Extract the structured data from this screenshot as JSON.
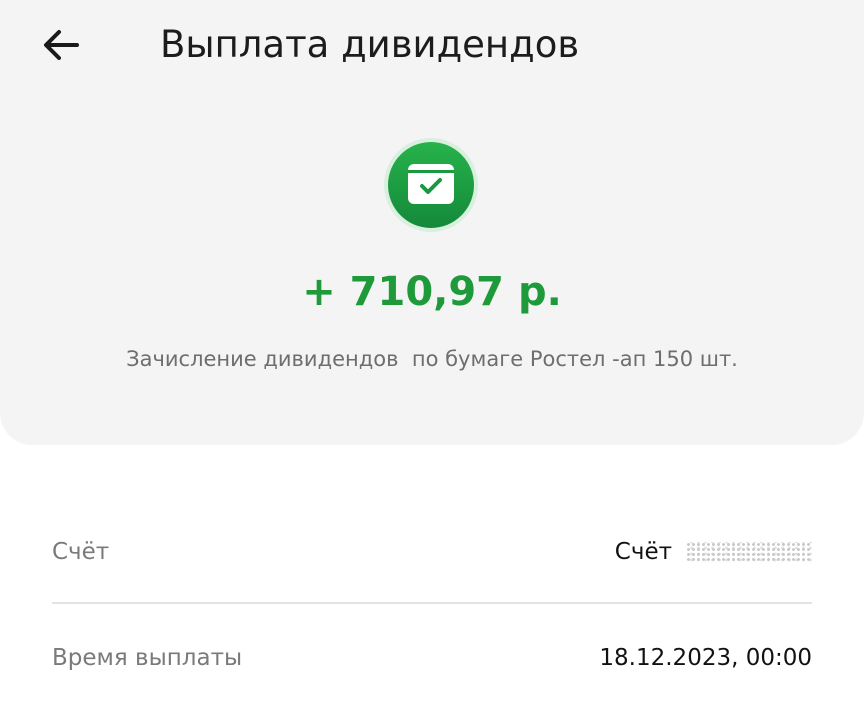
{
  "header": {
    "back_icon": "arrow-left-icon",
    "title": "Выплата дивидендов"
  },
  "operation": {
    "icon": "wallet-check-icon",
    "icon_color": "#1f9a3a",
    "amount": "+ 710,97 р.",
    "amount_color": "#1f9a3a",
    "description": "Зачисление дивидендов  по бумаге Ростел -ап 150 шт."
  },
  "details": {
    "account": {
      "label": "Счёт",
      "value_prefix": "Счёт"
    },
    "payout_time": {
      "label": "Время выплаты",
      "value": "18.12.2023, 00:00"
    }
  }
}
